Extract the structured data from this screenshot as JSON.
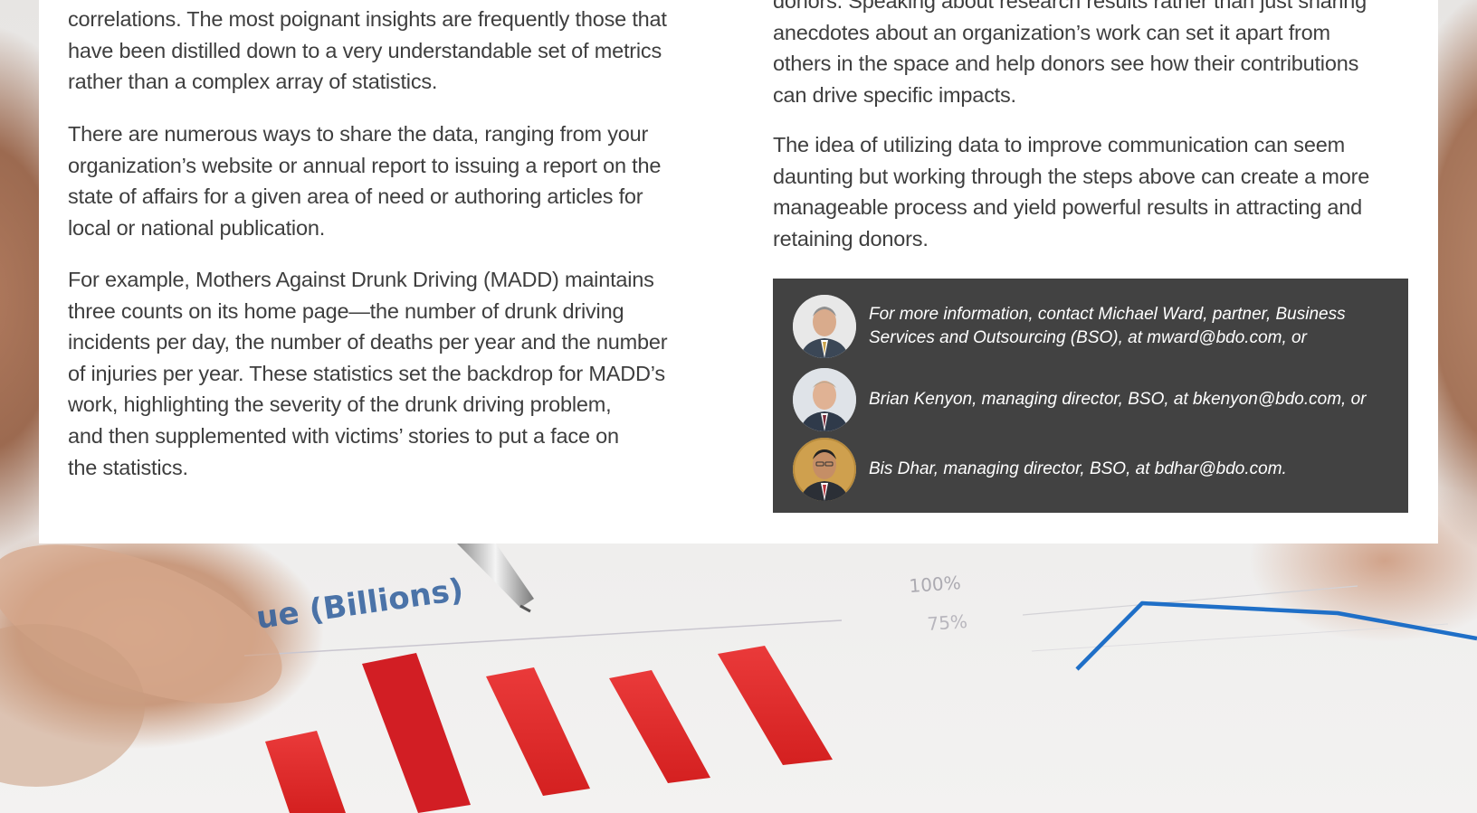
{
  "left_column": {
    "paragraphs": [
      {
        "lines": [
          "correlations. The most poignant insights are frequently those that",
          "have been distilled down to a very understandable set of metrics",
          "rather than a complex array of statistics."
        ]
      },
      {
        "lines": [
          "There are numerous ways to share the data, ranging from your",
          "organization’s website or annual report to issuing a report on the",
          "state of affairs for a given area of need or authoring articles for",
          "local or national publication."
        ]
      },
      {
        "lines": [
          "For example, Mothers Against Drunk Driving (MADD) maintains",
          "three counts on its home page—the number of drunk driving",
          "incidents per day, the number of deaths per year and the number",
          "of injuries per year. These statistics set the backdrop for MADD’s",
          "work, highlighting the severity of the drunk driving problem,",
          "and then supplemented with victims’ stories to put a face on",
          "the statistics."
        ]
      }
    ]
  },
  "right_column": {
    "paragraphs": [
      {
        "lines": [
          "donors. Speaking about research results rather than just sharing",
          "anecdotes about an organization’s work can set it apart from",
          "others in the space and help donors see how their contributions",
          "can drive specific impacts."
        ]
      },
      {
        "lines": [
          "The idea of utilizing data to improve communication can seem",
          "daunting but working through the steps above can create a more",
          "manageable process and yield powerful results in attracting and",
          "retaining donors."
        ]
      }
    ]
  },
  "contact_box": {
    "background": "#424242",
    "contacts": [
      {
        "lines": [
          "For more information, contact Michael Ward, partner, Business",
          "Services and Outsourcing (BSO), at mward@bdo.com, or"
        ]
      },
      {
        "lines": [
          "Brian Kenyon, managing director, BSO, at bkenyon@bdo.com, or"
        ]
      },
      {
        "lines": [
          "Bis Dhar, managing director, BSO, at bdhar@bdo.com."
        ]
      }
    ]
  },
  "background_photo": {
    "chart_heading_fragment": "ue (Billions)",
    "percent_labels": [
      "100%",
      "75%"
    ],
    "bar_color": "#e32a2a",
    "line_color": "#1f6fc7"
  }
}
